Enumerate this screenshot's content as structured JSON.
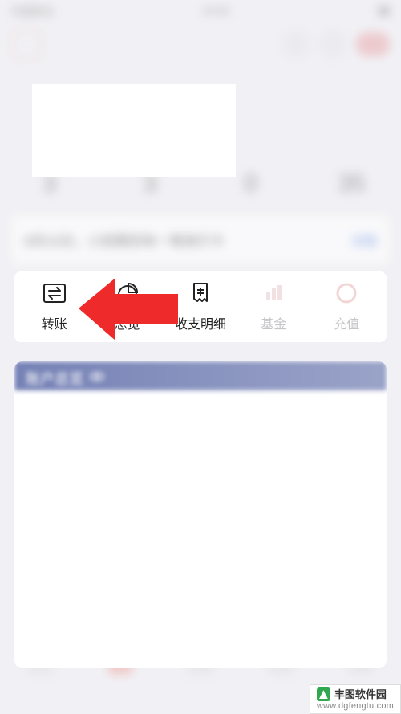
{
  "status": {
    "carrier": "中国移动",
    "time": "20:08"
  },
  "summary": [
    {
      "label": "",
      "value": "3"
    },
    {
      "label": "",
      "value": "3"
    },
    {
      "label": "",
      "value": "0"
    },
    {
      "label": "",
      "value": "35"
    }
  ],
  "notice": {
    "text": "9月15日，小招猜您有一笔他行卡",
    "action": "详情"
  },
  "actions": [
    {
      "label": "转账",
      "icon": "transfer-icon",
      "dim": false
    },
    {
      "label": "总览",
      "icon": "piechart-icon",
      "dim": false
    },
    {
      "label": "收支明细",
      "icon": "receipt-icon",
      "dim": false
    },
    {
      "label": "基金",
      "icon": "fund-icon",
      "dim": true
    },
    {
      "label": "充值",
      "icon": "ring-icon",
      "dim": true
    }
  ],
  "overview": {
    "title": "账户总览"
  },
  "watermark": {
    "name": "丰图软件园",
    "url": "www.dgfengtu.com"
  }
}
